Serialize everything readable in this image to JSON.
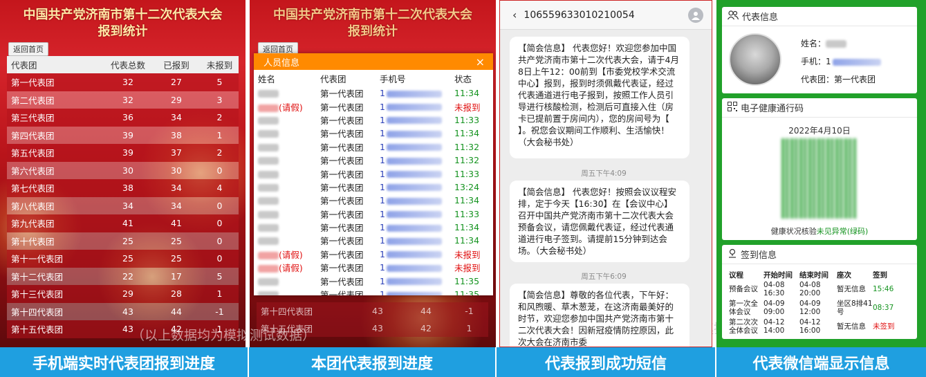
{
  "panel1": {
    "title_line1": "中国共产党济南市第十二次代表大会",
    "title_line2": "报到统计",
    "back_label": "返回首页",
    "headers": [
      "代表团",
      "代表总数",
      "已报到",
      "未报到"
    ],
    "rows": [
      [
        "第一代表团",
        "32",
        "27",
        "5"
      ],
      [
        "第二代表团",
        "32",
        "29",
        "3"
      ],
      [
        "第三代表团",
        "36",
        "34",
        "2"
      ],
      [
        "第四代表团",
        "39",
        "38",
        "1"
      ],
      [
        "第五代表团",
        "39",
        "37",
        "2"
      ],
      [
        "第六代表团",
        "30",
        "30",
        "0"
      ],
      [
        "第七代表团",
        "38",
        "34",
        "4"
      ],
      [
        "第八代表团",
        "34",
        "34",
        "0"
      ],
      [
        "第九代表团",
        "41",
        "41",
        "0"
      ],
      [
        "第十代表团",
        "25",
        "25",
        "0"
      ],
      [
        "第十一代表团",
        "25",
        "25",
        "0"
      ],
      [
        "第十二代表团",
        "22",
        "17",
        "5"
      ],
      [
        "第十三代表团",
        "29",
        "28",
        "1"
      ],
      [
        "第十四代表团",
        "43",
        "44",
        "-1"
      ],
      [
        "第十五代表团",
        "43",
        "42",
        "1"
      ]
    ]
  },
  "panel2": {
    "title_line1": "中国共产党济南市第十二次代表大会",
    "title_line2": "报到统计",
    "back_label": "返回首页",
    "modal_title": "人员信息",
    "close_glyph": "×",
    "headers": [
      "姓名",
      "代表团",
      "手机号",
      "状态"
    ],
    "rows": [
      {
        "suffix": "",
        "team": "第一代表团",
        "phone_prefix": "1",
        "status": "11:34",
        "status_color": "#14931f"
      },
      {
        "suffix": "(请假)",
        "team": "第一代表团",
        "phone_prefix": "1",
        "status": "未报到",
        "status_color": "#e01010"
      },
      {
        "suffix": "",
        "team": "第一代表团",
        "phone_prefix": "1",
        "status": "11:33",
        "status_color": "#14931f"
      },
      {
        "suffix": "",
        "team": "第一代表团",
        "phone_prefix": "1",
        "status": "11:34",
        "status_color": "#14931f"
      },
      {
        "suffix": "",
        "team": "第一代表团",
        "phone_prefix": "1",
        "status": "11:32",
        "status_color": "#14931f"
      },
      {
        "suffix": "",
        "team": "第一代表团",
        "phone_prefix": "1",
        "status": "11:32",
        "status_color": "#14931f"
      },
      {
        "suffix": "",
        "team": "第一代表团",
        "phone_prefix": "1",
        "status": "11:33",
        "status_color": "#14931f"
      },
      {
        "suffix": "",
        "team": "第一代表团",
        "phone_prefix": "1",
        "status": "13:24",
        "status_color": "#14931f"
      },
      {
        "suffix": "",
        "team": "第一代表团",
        "phone_prefix": "1",
        "status": "11:34",
        "status_color": "#14931f"
      },
      {
        "suffix": "",
        "team": "第一代表团",
        "phone_prefix": "1",
        "status": "11:33",
        "status_color": "#14931f"
      },
      {
        "suffix": "",
        "team": "第一代表团",
        "phone_prefix": "1",
        "status": "11:34",
        "status_color": "#14931f"
      },
      {
        "suffix": "",
        "team": "第一代表团",
        "phone_prefix": "1",
        "status": "11:34",
        "status_color": "#14931f"
      },
      {
        "suffix": "(请假)",
        "team": "第一代表团",
        "phone_prefix": "1",
        "status": "未报到",
        "status_color": "#e01010"
      },
      {
        "suffix": "(请假)",
        "team": "第一代表团",
        "phone_prefix": "1",
        "status": "未报到",
        "status_color": "#e01010"
      },
      {
        "suffix": "",
        "team": "第一代表团",
        "phone_prefix": "1",
        "status": "11:35",
        "status_color": "#14931f"
      },
      {
        "suffix": "",
        "team": "第一代表团",
        "phone_prefix": "1",
        "status": "11:35",
        "status_color": "#14931f"
      }
    ],
    "bg_rows": [
      [
        "第十四代表团",
        "43",
        "44",
        "-1"
      ],
      [
        "第十五代表团",
        "43",
        "42",
        "1"
      ]
    ]
  },
  "watermark": "（以上数据均为模拟测试数据）",
  "panel3": {
    "sender": "106559633010210054",
    "msg1": "【简会信息】        代表您好！欢迎您参加中国共产党济南市第十二次代表大会，请于4月8日上午12：00前到【市委党校学术交流中心】报到，报到时须佩戴代表证，经过代表通道进行电子报到，按照工作人员引导进行核酸检测，检测后可直接入住（房卡已提前置于房间内），您的房间号为【                    】。祝您会议期间工作顺利、生活愉快！（大会秘书处）",
    "ts1": "周五下午4:09",
    "msg2": "【简会信息】        代表您好！按照会议议程安排，定于今天【16:30】在【会议中心】召开中国共产党济南市第十二次代表大会预备会议，请您佩戴代表证，经过代表通道进行电子签到。请提前15分钟到达会场。（大会秘书处）",
    "ts2": "周五下午6:09",
    "msg3": "【简会信息】尊敬的各位代表，下午好：\n    和风煦暖、草木葱茏，在这济南最美好的时节，欢迎您参加中国共产党济南市第十二次代表大会！因新冠疫情防控原因，此次大会在济南市委"
  },
  "panel4": {
    "card1_title": "代表信息",
    "name_label": "姓名：",
    "phone_label": "手机：1",
    "team_label": "代表团：第一代表团",
    "card2_title": "电子健康通行码",
    "date": "2022年4月10日",
    "health_prefix": "健康状况核验",
    "health_status": "未见异常(绿码)",
    "card3_title": "签到信息",
    "sign_headers": [
      "议程",
      "开始时间",
      "结束时间",
      "座次",
      "签到"
    ],
    "sign_rows": [
      {
        "name": "预备会议",
        "start": "04-08 16:30",
        "end": "04-08 20:00",
        "seat": "暂无信息",
        "sign": "15:46",
        "color": "#14931f"
      },
      {
        "name": "第一次全体会议",
        "start": "04-09 09:00",
        "end": "04-09 12:00",
        "seat": "坐区8排41号",
        "sign": "08:37",
        "color": "#14931f"
      },
      {
        "name": "第二次次全体会议",
        "start": "04-12 14:00",
        "end": "04-12 16:00",
        "seat": "暂无信息",
        "sign": "未签到",
        "color": "#e01010"
      }
    ]
  },
  "captions": [
    "手机端实时代表团报到进度",
    "本团代表报到进度",
    "代表报到成功短信",
    "代表微信端显示信息"
  ]
}
